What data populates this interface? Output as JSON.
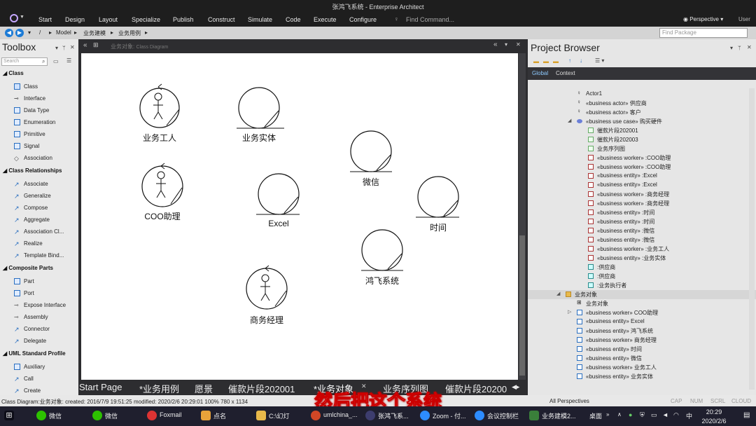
{
  "window": {
    "title": "张鸿飞系统 - Enterprise Architect"
  },
  "menu": [
    "Start",
    "Design",
    "Layout",
    "Specialize",
    "Publish",
    "Construct",
    "Simulate",
    "Code",
    "Execute",
    "Configure"
  ],
  "find_command": "Find Command...",
  "perspective": "Perspective",
  "user": "User",
  "breadcrumb": [
    "Model",
    "业务建模",
    "业务用例"
  ],
  "find_package": "Find Package",
  "toolbox": {
    "title": "Toolbox",
    "search_placeholder": "Search",
    "groups": [
      {
        "title": "Class",
        "items": [
          "Class",
          "Interface",
          "Data Type",
          "Enumeration",
          "Primitive",
          "Signal",
          "Association"
        ]
      },
      {
        "title": "Class Relationships",
        "items": [
          "Associate",
          "Generalize",
          "Compose",
          "Aggregate",
          "Association Cl...",
          "Realize",
          "Template Bind..."
        ]
      },
      {
        "title": "Composite Parts",
        "items": [
          "Part",
          "Port",
          "Expose Interface",
          "Assembly",
          "Connector",
          "Delegate"
        ]
      },
      {
        "title": "UML Standard Profile",
        "items": [
          "Auxiliary",
          "Call",
          "Create"
        ]
      }
    ]
  },
  "diagram": {
    "tab_label": "业务对象",
    "tab_kind": "Class Diagram",
    "elements": [
      {
        "label": "业务工人"
      },
      {
        "label": "业务实体"
      },
      {
        "label": "COO助理"
      },
      {
        "label": "Excel"
      },
      {
        "label": "微信"
      },
      {
        "label": "时间"
      },
      {
        "label": "鸿飞系统"
      },
      {
        "label": "商务经理"
      }
    ]
  },
  "doc_tabs": [
    "Start Page",
    "*业务用例",
    "愿景",
    "催款片段202001",
    "*业务对象",
    "业务序列图",
    "催款片段20200"
  ],
  "browser": {
    "title": "Project Browser",
    "tabs": [
      "Global",
      "Context"
    ],
    "tree": [
      "Actor1",
      "«business actor» 供应商",
      "«business actor» 客户",
      "«business use case» 购买硬件",
      "催款片段202001",
      "催款片段202003",
      "业务序列图",
      "«business worker» :COO助理",
      "«business worker» :COO助理",
      "«business entity» :Excel",
      "«business entity» :Excel",
      "«business worker» :商务经理",
      "«business worker» :商务经理",
      "«business entity» :时间",
      "«business entity» :时间",
      "«business entity» :微信",
      "«business entity» :微信",
      "«business worker» :业务工人",
      "«business entity» :业务实体",
      ":供应商",
      ":供应商",
      ":业务执行者",
      "业务对象",
      "业务对象",
      "«business worker» COO助理",
      "«business entity» Excel",
      "«business entity» 鸿飞系统",
      "«business worker» 商务经理",
      "«business entity» 时间",
      "«business entity» 微信",
      "«business worker» 业务工人",
      "«business entity» 业务实体"
    ]
  },
  "status": {
    "text": "Class Diagram:业务对象:   created: 2016/7/9 19:51:25  modified: 2020/2/6 20:29:01   100%   780 x 1134",
    "right": "All Perspectives",
    "flags": [
      "CAP",
      "NUM",
      "SCRL",
      "CLOUD"
    ]
  },
  "subtitle": "然后把这个系统",
  "taskbar": {
    "items": [
      "微信",
      "微信",
      "Foxmail",
      "点名",
      "C:\\幻灯",
      "umlchina_...",
      "张鸿飞系...",
      "Zoom - 付...",
      "会议控制栏",
      "业务建模2..."
    ],
    "tray_desktop": "桌面",
    "tray_ime": "中",
    "time": "20:29",
    "date": "2020/2/6"
  },
  "colors": {
    "menubar": "#1e1e1e",
    "accent": "#1c7bd6",
    "subtitle_outline": "#cc0000"
  }
}
